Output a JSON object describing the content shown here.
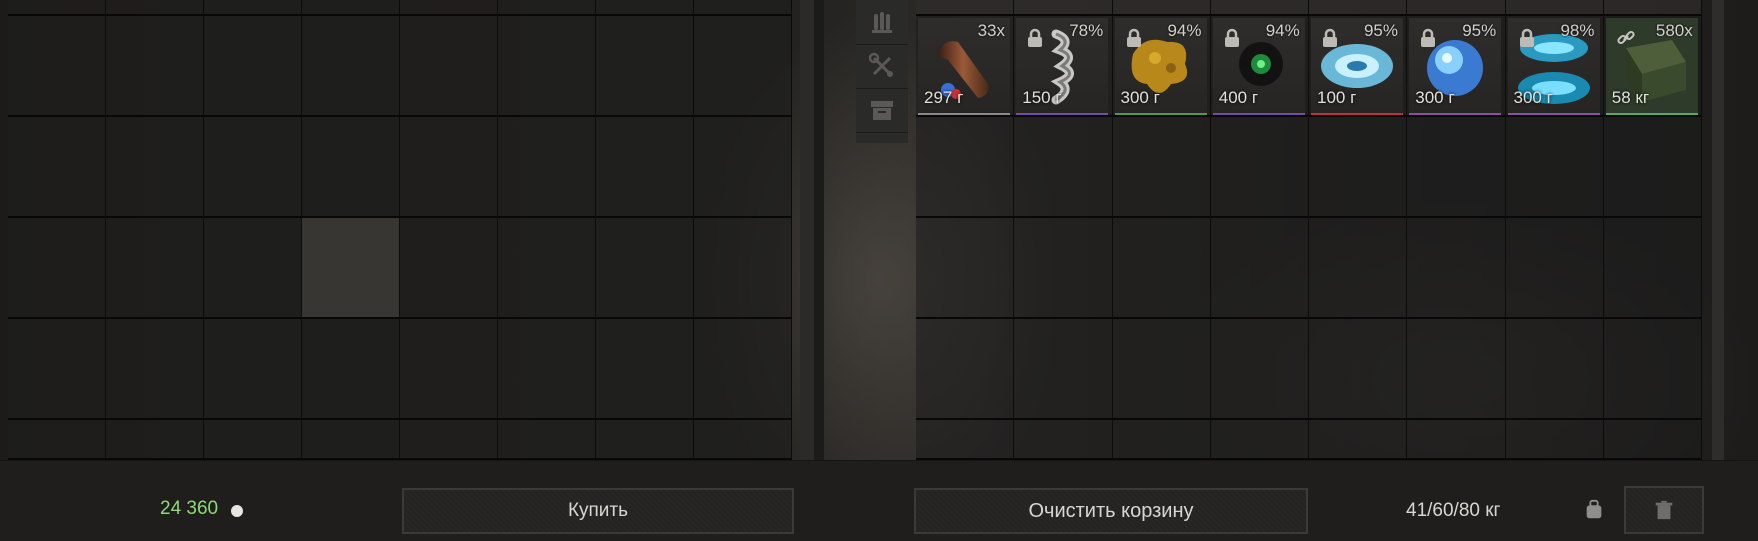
{
  "left_grid": {
    "columns": 8,
    "highlighted_cell": "row-3-col-4"
  },
  "tools": {
    "items": [
      {
        "name": "ammo-icon"
      },
      {
        "name": "wrench-screwdriver-icon"
      },
      {
        "name": "archive-box-icon"
      }
    ]
  },
  "cart_items": [
    {
      "name": "ammo",
      "count": "33x",
      "weight": "297 г",
      "locked": false,
      "border": "#8a8a8a"
    },
    {
      "name": "drill-spiral",
      "count": "78%",
      "weight": "150 г",
      "locked": true,
      "border": "#6f4fa0"
    },
    {
      "name": "yellow-sponge",
      "count": "94%",
      "weight": "300 г",
      "locked": true,
      "border": "#4f9a4a"
    },
    {
      "name": "green-urchin",
      "count": "94%",
      "weight": "400 г",
      "locked": true,
      "border": "#6f4fa0"
    },
    {
      "name": "blue-vortex",
      "count": "95%",
      "weight": "100 г",
      "locked": true,
      "border": "#c0303a"
    },
    {
      "name": "blue-sphere",
      "count": "95%",
      "weight": "300 г",
      "locked": true,
      "border": "#8a4fa0"
    },
    {
      "name": "blue-crystal-disks",
      "count": "98%",
      "weight": "300 г",
      "locked": true,
      "border": "#8a4fa0"
    },
    {
      "name": "ammo-crate",
      "count": "580x",
      "weight": "58 кг",
      "locked": false,
      "linked": true,
      "border": "#5aa860"
    }
  ],
  "footer": {
    "money": "24 360",
    "buy_label": "Купить",
    "clear_cart_label": "Очистить корзину",
    "capacity": "41/60/80 кг"
  },
  "colors": {
    "money": "#8ed97a",
    "text": "#d8d6d0"
  }
}
